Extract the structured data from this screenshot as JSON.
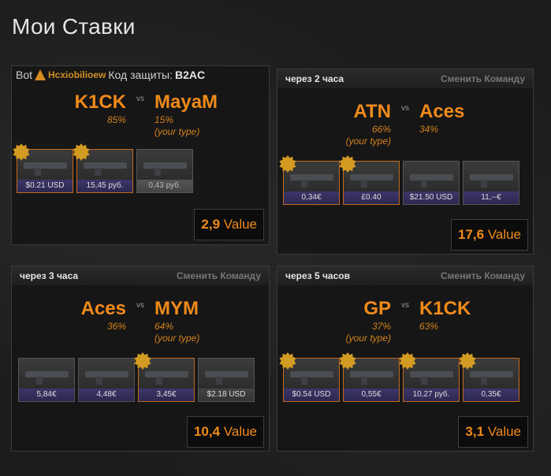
{
  "page_title": "Мои Ставки",
  "cards": [
    {
      "bot_label": "Bot",
      "bot_name": "Hcxiobilioew",
      "code_label": "Код защиты:",
      "code": "B2AC",
      "team_left": {
        "name": "K1CK",
        "pct": "85%"
      },
      "team_right": {
        "name": "MayaM",
        "pct": "15%",
        "your_type": "(your type)"
      },
      "vs": "vs",
      "items": [
        {
          "price": "$0.21 USD",
          "mine": true
        },
        {
          "price": "15,45 руб.",
          "mine": true
        },
        {
          "price": "0,43 руб.",
          "mine": false
        }
      ],
      "value_amount": "2,9",
      "value_label": "Value"
    },
    {
      "time": "через 2 часа",
      "change": "Сменить Команду",
      "team_left": {
        "name": "ATN",
        "pct": "66%",
        "your_type": "(your type)"
      },
      "team_right": {
        "name": "Aces",
        "pct": "34%"
      },
      "vs": "vs",
      "items": [
        {
          "price": "0,34€",
          "mine": true
        },
        {
          "price": "£0.40",
          "mine": true
        },
        {
          "price": "$21.50 USD",
          "mine": false
        },
        {
          "price": "11,--€",
          "mine": false
        }
      ],
      "value_amount": "17,6",
      "value_label": "Value"
    },
    {
      "time": "через 3 часа",
      "change": "Сменить Команду",
      "team_left": {
        "name": "Aces",
        "pct": "36%"
      },
      "team_right": {
        "name": "MYM",
        "pct": "64%",
        "your_type": "(your type)"
      },
      "vs": "vs",
      "items": [
        {
          "price": "5,84€",
          "mine": false
        },
        {
          "price": "4,48€",
          "mine": false
        },
        {
          "price": "3,45€",
          "mine": true
        },
        {
          "price": "$2.18 USD",
          "mine": false
        }
      ],
      "value_amount": "10,4",
      "value_label": "Value"
    },
    {
      "time": "через 5 часов",
      "change": "Сменить Команду",
      "team_left": {
        "name": "GP",
        "pct": "37%",
        "your_type": "(your type)"
      },
      "team_right": {
        "name": "K1CK",
        "pct": "63%"
      },
      "vs": "vs",
      "items": [
        {
          "price": "$0.54 USD",
          "mine": true
        },
        {
          "price": "0,55€",
          "mine": true
        },
        {
          "price": "10,27 руб.",
          "mine": true
        },
        {
          "price": "0,35€",
          "mine": true
        }
      ],
      "value_amount": "3,1",
      "value_label": "Value"
    }
  ],
  "colors": {
    "accent": "#f08a1a",
    "badge": "#d39b22",
    "price_bar": "#3c3568"
  }
}
